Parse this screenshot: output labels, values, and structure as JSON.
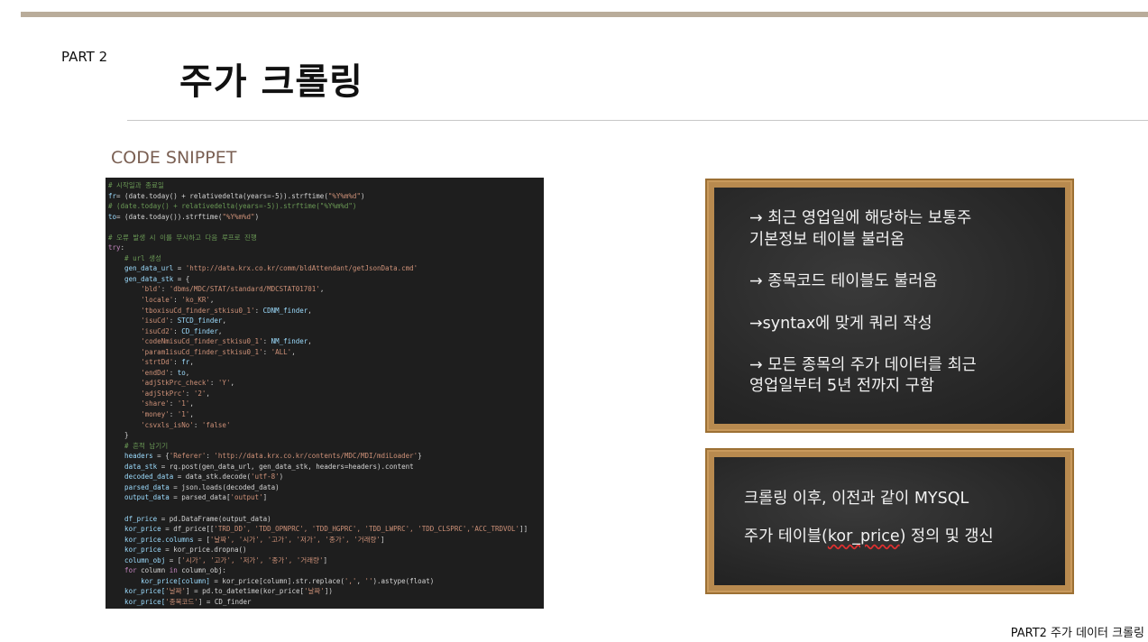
{
  "header": {
    "part": "PART 2",
    "title": "주가 크롤링"
  },
  "section_label": "CODE SNIPPET",
  "code": {
    "lines": [
      [
        [
          "c-com",
          "# 시작일과 종료일"
        ]
      ],
      [
        [
          "c-var",
          "fr"
        ],
        [
          "",
          "= (date.today() + relativedelta(years=-5)).strftime("
        ],
        [
          "c-str",
          "\"%Y%m%d\""
        ],
        [
          "",
          ")"
        ]
      ],
      [
        [
          "c-com",
          "# (date.today() + relativedelta(years=-5)).strftime(\"%Y%m%d\")"
        ]
      ],
      [
        [
          "c-var",
          "to"
        ],
        [
          "",
          "= (date.today()).strftime("
        ],
        [
          "c-str",
          "\"%Y%m%d\""
        ],
        [
          "",
          ")"
        ]
      ],
      [
        [
          "",
          ""
        ]
      ],
      [
        [
          "c-com",
          "# 오류 발생 시 이를 무시하고 다음 루프로 진행"
        ]
      ],
      [
        [
          "c-kw",
          "try"
        ],
        [
          "",
          ":"
        ]
      ],
      [
        [
          "c-com",
          "    # url 생성"
        ]
      ],
      [
        [
          "c-var",
          "    gen_data_url"
        ],
        [
          "",
          " = "
        ],
        [
          "c-str",
          "'http://data.krx.co.kr/comm/bldAttendant/getJsonData.cmd'"
        ]
      ],
      [
        [
          "c-var",
          "    gen_data_stk"
        ],
        [
          "",
          " = {"
        ]
      ],
      [
        [
          "c-str",
          "        'bld'"
        ],
        [
          "",
          ": "
        ],
        [
          "c-str",
          "'dbms/MDC/STAT/standard/MDCSTAT01701'"
        ],
        [
          "",
          ","
        ]
      ],
      [
        [
          "c-str",
          "        'locale'"
        ],
        [
          "",
          ": "
        ],
        [
          "c-str",
          "'ko_KR'"
        ],
        [
          "",
          ","
        ]
      ],
      [
        [
          "c-str",
          "        'tboxisuCd_finder_stkisu0_1'"
        ],
        [
          "",
          ": "
        ],
        [
          "c-var",
          "CDNM_finder"
        ],
        [
          "",
          ","
        ]
      ],
      [
        [
          "c-str",
          "        'isuCd'"
        ],
        [
          "",
          ": "
        ],
        [
          "c-var",
          "STCD_finder"
        ],
        [
          "",
          ","
        ]
      ],
      [
        [
          "c-str",
          "        'isuCd2'"
        ],
        [
          "",
          ": "
        ],
        [
          "c-var",
          "CD_finder"
        ],
        [
          "",
          ","
        ]
      ],
      [
        [
          "c-str",
          "        'codeNmisuCd_finder_stkisu0_1'"
        ],
        [
          "",
          ": "
        ],
        [
          "c-var",
          "NM_finder"
        ],
        [
          "",
          ","
        ]
      ],
      [
        [
          "c-str",
          "        'param1isuCd_finder_stkisu0_1'"
        ],
        [
          "",
          ": "
        ],
        [
          "c-str",
          "'ALL'"
        ],
        [
          "",
          ","
        ]
      ],
      [
        [
          "c-str",
          "        'strtDd'"
        ],
        [
          "",
          ": "
        ],
        [
          "c-var",
          "fr"
        ],
        [
          "",
          ","
        ]
      ],
      [
        [
          "c-str",
          "        'endDd'"
        ],
        [
          "",
          ": "
        ],
        [
          "c-var",
          "to"
        ],
        [
          "",
          ","
        ]
      ],
      [
        [
          "c-str",
          "        'adjStkPrc_check'"
        ],
        [
          "",
          ": "
        ],
        [
          "c-str",
          "'Y'"
        ],
        [
          "",
          ","
        ]
      ],
      [
        [
          "c-str",
          "        'adjStkPrc'"
        ],
        [
          "",
          ": "
        ],
        [
          "c-str",
          "'2'"
        ],
        [
          "",
          ","
        ]
      ],
      [
        [
          "c-str",
          "        'share'"
        ],
        [
          "",
          ": "
        ],
        [
          "c-str",
          "'1'"
        ],
        [
          "",
          ","
        ]
      ],
      [
        [
          "c-str",
          "        'money'"
        ],
        [
          "",
          ": "
        ],
        [
          "c-str",
          "'1'"
        ],
        [
          "",
          ","
        ]
      ],
      [
        [
          "c-str",
          "        'csvxls_isNo'"
        ],
        [
          "",
          ": "
        ],
        [
          "c-str",
          "'false'"
        ]
      ],
      [
        [
          "",
          "    }"
        ]
      ],
      [
        [
          "c-com",
          "    # 흔적 남기기"
        ]
      ],
      [
        [
          "c-var",
          "    headers"
        ],
        [
          "",
          " = {"
        ],
        [
          "c-str",
          "'Referer'"
        ],
        [
          "",
          ": "
        ],
        [
          "c-str",
          "'http://data.krx.co.kr/contents/MDC/MDI/mdiLoader'"
        ],
        [
          "",
          "}"
        ]
      ],
      [
        [
          "c-var",
          "    data_stk"
        ],
        [
          "",
          " = rq.post(gen_data_url, gen_data_stk, headers=headers).content"
        ]
      ],
      [
        [
          "c-var",
          "    decoded_data"
        ],
        [
          "",
          " = data_stk.decode("
        ],
        [
          "c-str",
          "'utf-8'"
        ],
        [
          "",
          ")"
        ]
      ],
      [
        [
          "c-var",
          "    parsed_data"
        ],
        [
          "",
          " = json.loads(decoded_data)"
        ]
      ],
      [
        [
          "c-var",
          "    output_data"
        ],
        [
          "",
          " = parsed_data["
        ],
        [
          "c-str",
          "'output'"
        ],
        [
          "",
          "]"
        ]
      ],
      [
        [
          "",
          ""
        ]
      ],
      [
        [
          "c-var",
          "    df_price"
        ],
        [
          "",
          " = pd.DataFrame(output_data)"
        ]
      ],
      [
        [
          "c-var",
          "    kor_price"
        ],
        [
          "",
          " = df_price[["
        ],
        [
          "c-str",
          "'TRD_DD', 'TDD_OPNPRC', 'TDD_HGPRC', 'TDD_LWPRC', 'TDD_CLSPRC','ACC_TRDVOL'"
        ],
        [
          "",
          "]]"
        ]
      ],
      [
        [
          "c-var",
          "    kor_price.columns"
        ],
        [
          "",
          " = ["
        ],
        [
          "c-str",
          "'날짜', '시가', '고가', '저가', '종가', '거래량'"
        ],
        [
          "",
          "]"
        ]
      ],
      [
        [
          "c-var",
          "    kor_price"
        ],
        [
          "",
          " = kor_price.dropna()"
        ]
      ],
      [
        [
          "c-var",
          "    column_obj"
        ],
        [
          "",
          " = ["
        ],
        [
          "c-str",
          "'시가', '고가', '저가', '종가', '거래량'"
        ],
        [
          "",
          "]"
        ]
      ],
      [
        [
          "c-kw",
          "    for"
        ],
        [
          "",
          " column "
        ],
        [
          "c-kw",
          "in"
        ],
        [
          "",
          " column_obj:"
        ]
      ],
      [
        [
          "c-var",
          "        kor_price[column]"
        ],
        [
          "",
          " = kor_price[column].str.replace("
        ],
        [
          "c-str",
          "','"
        ],
        [
          "",
          ", "
        ],
        [
          "c-str",
          "''"
        ],
        [
          "",
          ").astype(float)"
        ]
      ],
      [
        [
          "c-var",
          "    kor_price["
        ],
        [
          "c-str",
          "'날짜'"
        ],
        [
          "",
          "] = pd.to_datetime(kor_price["
        ],
        [
          "c-str",
          "'날짜'"
        ],
        [
          "",
          "])"
        ]
      ],
      [
        [
          "c-var",
          "    kor_price["
        ],
        [
          "c-str",
          "'종목코드'"
        ],
        [
          "",
          "] = CD_finder"
        ]
      ]
    ]
  },
  "board1": {
    "lines": [
      "→ 최근 영업일에 해당하는 보통주",
      "기본정보 테이블 불러옴",
      "→ 종목코드 테이블도 불러옴",
      "→syntax에 맞게 쿼리 작성",
      "→ 모든 종목의 주가 데이터를 최근",
      "영업일부터 5년 전까지  구함"
    ]
  },
  "board2": {
    "line1": "크롤링 이후, 이전과 같이 MYSQL",
    "line2_pre": "주가 테이블(",
    "line2_mid": "kor_price",
    "line2_post": ") 정의 및 갱신"
  },
  "footer": "PART2 주가 데이터 크롤링"
}
